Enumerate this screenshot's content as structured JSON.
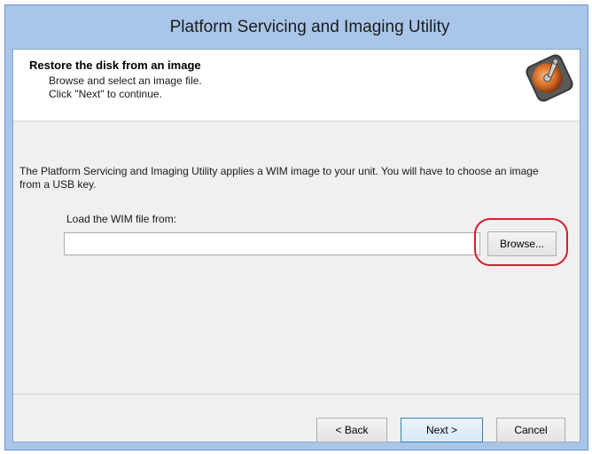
{
  "window": {
    "title": "Platform Servicing and Imaging Utility"
  },
  "header": {
    "title": "Restore the disk from an image",
    "line1": "Browse and select an image file.",
    "line2": "Click \"Next\" to continue.",
    "icon": "hard-disk-icon"
  },
  "content": {
    "description": "The Platform Servicing and Imaging Utility applies a WIM image to your unit. You will have to choose an image from a USB key.",
    "load_label": "Load the WIM file from:",
    "path_value": "",
    "browse_label": "Browse..."
  },
  "footer": {
    "back_label": "< Back",
    "next_label": "Next >",
    "cancel_label": "Cancel"
  },
  "colors": {
    "frame": "#a9c6e8",
    "highlight": "#d21f2c"
  }
}
